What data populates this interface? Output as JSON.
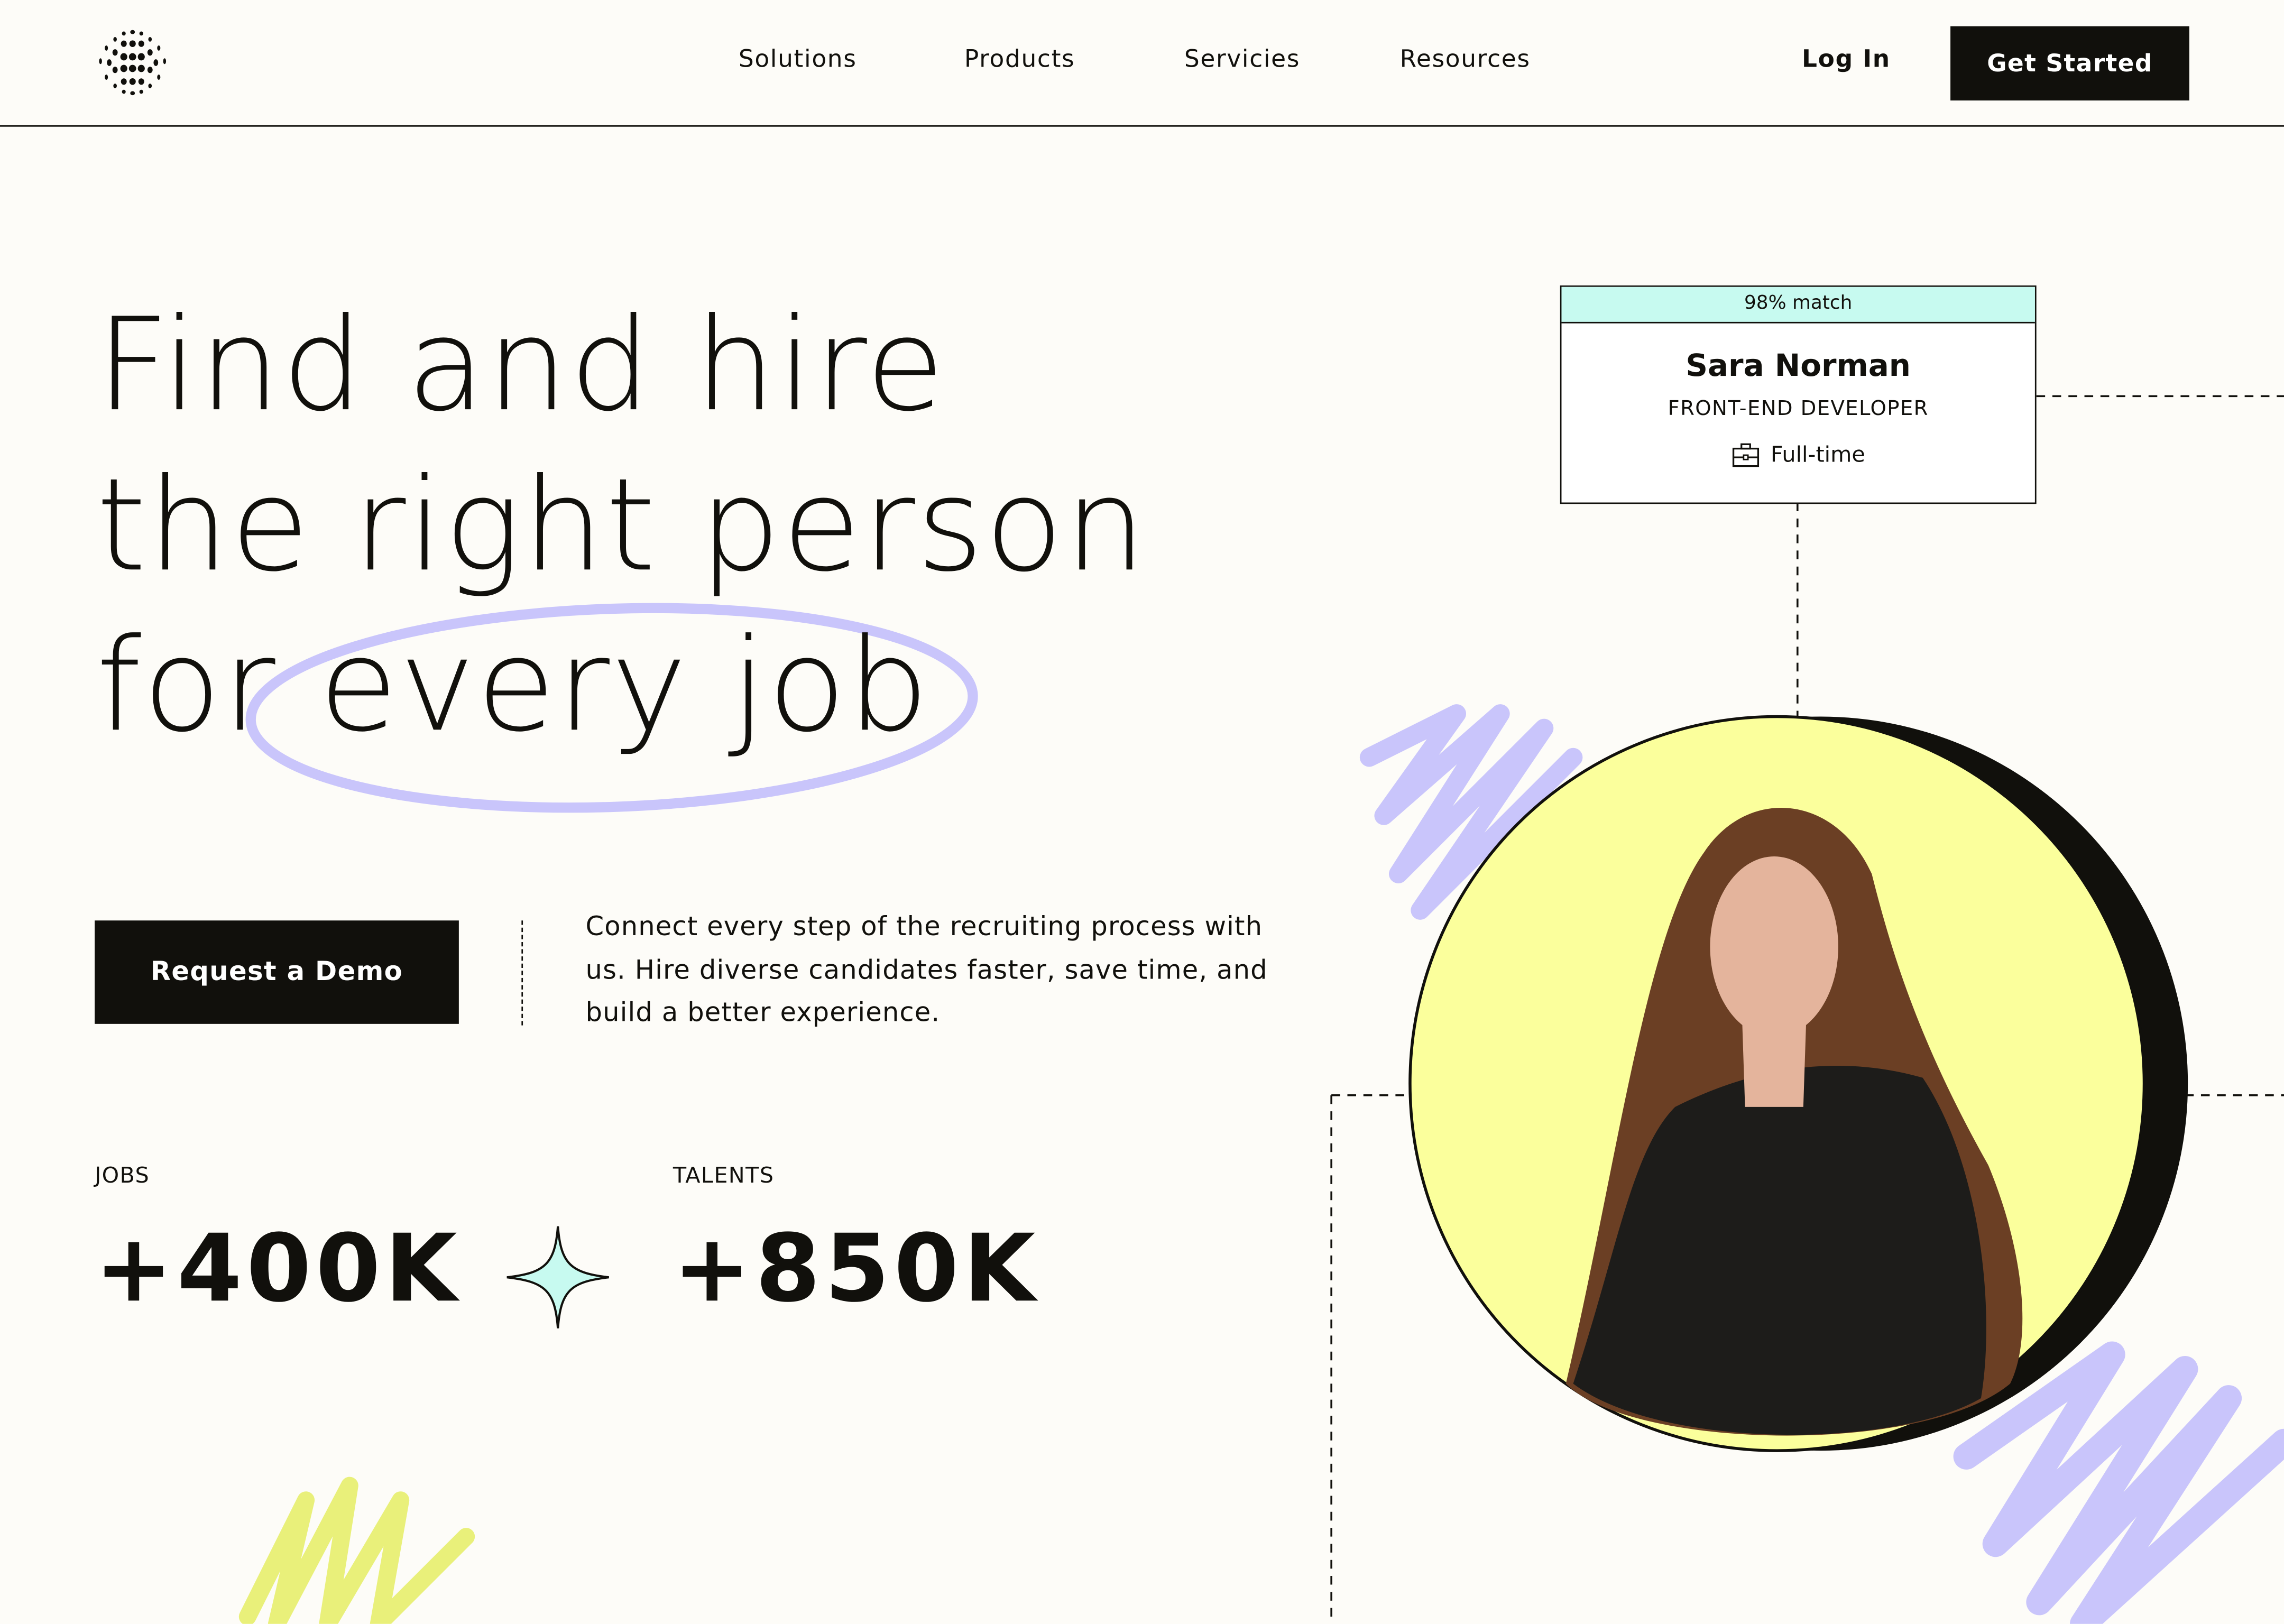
{
  "nav": {
    "logo": "dotted-globe-logo",
    "links": [
      "Solutions",
      "Products",
      "Servicies",
      "Resources"
    ],
    "login": "Log In",
    "cta": "Get Started"
  },
  "hero": {
    "lines": [
      "Find and hire",
      "the right person",
      "for every job"
    ],
    "demo_button": "Request a Demo",
    "description": "Connect every step of the recruiting process with us. Hire diverse candidates faster, save time, and build a better experience."
  },
  "stats": [
    {
      "label": "JOBS",
      "value": "+400K"
    },
    {
      "label": "TALENTS",
      "value": "+850K"
    }
  ],
  "profile_card": {
    "match": "98% match",
    "name": "Sara Norman",
    "role": "FRONT-END DEVELOPER",
    "employment": "Full-time",
    "employment_icon": "briefcase-icon"
  },
  "colors": {
    "ink": "#11100c",
    "background": "#fdfcf8",
    "mint": "#c7faf0",
    "lavender": "#c9c5fb",
    "yellow": "#fbff9c",
    "lime_scribble": "#e9f07a"
  }
}
